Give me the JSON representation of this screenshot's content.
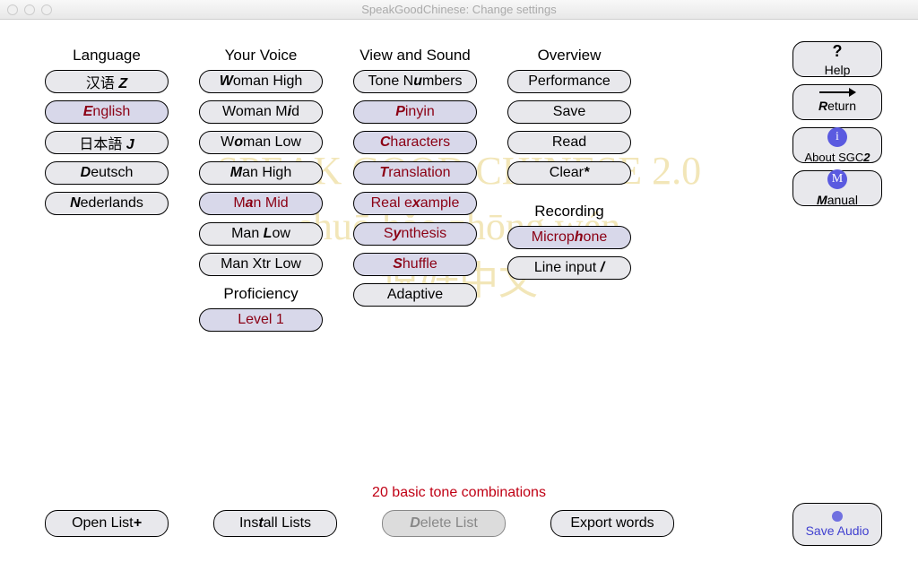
{
  "window": {
    "title": "SpeakGoodChinese: Change settings"
  },
  "watermark": {
    "line1": "SPEAK GOOD CHINESE 2.0",
    "line2": "shuō hǎo zhōng wén",
    "line3": "说好中文"
  },
  "columns": {
    "language": {
      "title": "Language",
      "items": [
        {
          "pre": "汉语 ",
          "hot": "Z",
          "post": "",
          "sel": false
        },
        {
          "pre": "",
          "hot": "E",
          "post": "nglish",
          "sel": true
        },
        {
          "pre": "日本語 ",
          "hot": "J",
          "post": "",
          "sel": false
        },
        {
          "pre": "",
          "hot": "D",
          "post": "eutsch",
          "sel": false
        },
        {
          "pre": "",
          "hot": "N",
          "post": "ederlands",
          "sel": false
        }
      ]
    },
    "voice": {
      "title": "Your Voice",
      "items": [
        {
          "pre": "",
          "hot": "W",
          "post": "oman High",
          "sel": false
        },
        {
          "pre": "Woman M",
          "hot": "i",
          "post": "d",
          "sel": false
        },
        {
          "pre": "W",
          "hot": "o",
          "post": "man Low",
          "sel": false
        },
        {
          "pre": "",
          "hot": "M",
          "post": "an High",
          "sel": false
        },
        {
          "pre": "M",
          "hot": "a",
          "post": "n Mid",
          "sel": true
        },
        {
          "pre": "Man ",
          "hot": "L",
          "post": "ow",
          "sel": false
        },
        {
          "pre": "Man Xtr Low",
          "hot": "",
          "post": "",
          "sel": false
        }
      ],
      "prof_title": "Proficiency",
      "prof_item": {
        "pre": "Level 1",
        "hot": "",
        "post": "",
        "sel": true
      }
    },
    "view": {
      "title": "View and Sound",
      "items": [
        {
          "pre": "Tone N",
          "hot": "u",
          "post": "mbers",
          "sel": false
        },
        {
          "pre": "",
          "hot": "P",
          "post": "inyin",
          "sel": true
        },
        {
          "pre": "",
          "hot": "C",
          "post": "haracters",
          "sel": true
        },
        {
          "pre": "",
          "hot": "T",
          "post": "ranslation",
          "sel": true
        },
        {
          "pre": "Real e",
          "hot": "x",
          "post": "ample",
          "sel": true
        },
        {
          "pre": "S",
          "hot": "y",
          "post": "nthesis",
          "sel": true
        },
        {
          "pre": "",
          "hot": "S",
          "post": "huffle",
          "sel": true
        },
        {
          "pre": "Adaptive",
          "hot": "",
          "post": "",
          "sel": false
        }
      ]
    },
    "overview": {
      "title": "Overview",
      "items": [
        {
          "pre": "Performance",
          "hot": "",
          "post": "",
          "sel": false
        },
        {
          "pre": "Save",
          "hot": "",
          "post": "",
          "sel": false
        },
        {
          "pre": "Read",
          "hot": "",
          "post": "",
          "sel": false
        },
        {
          "pre": "Clear",
          "hot": "*",
          "post": "",
          "sel": false
        }
      ],
      "rec_title": "Recording",
      "rec_items": [
        {
          "pre": "Microp",
          "hot": "h",
          "post": "one",
          "sel": true
        },
        {
          "pre": "Line input ",
          "hot": "/",
          "post": "",
          "sel": false
        }
      ]
    }
  },
  "side": {
    "help": {
      "q": "?",
      "label": "Help"
    },
    "ret": {
      "pre": "",
      "hot": "R",
      "post": "eturn"
    },
    "about": {
      "pre": "About SGC",
      "hot": "2",
      "post": ""
    },
    "manual": {
      "letter": "M",
      "pre": "",
      "hot": "M",
      "post": "anual"
    }
  },
  "status": "20 basic tone combinations",
  "bottom": {
    "open": {
      "pre": "Open List",
      "hot": "+",
      "post": ""
    },
    "install": {
      "pre": "Ins",
      "hot": "t",
      "post": "all Lists"
    },
    "delete": {
      "pre": "",
      "hot": "D",
      "post": "elete List"
    },
    "export": "Export words",
    "save_audio": "Save Audio"
  }
}
